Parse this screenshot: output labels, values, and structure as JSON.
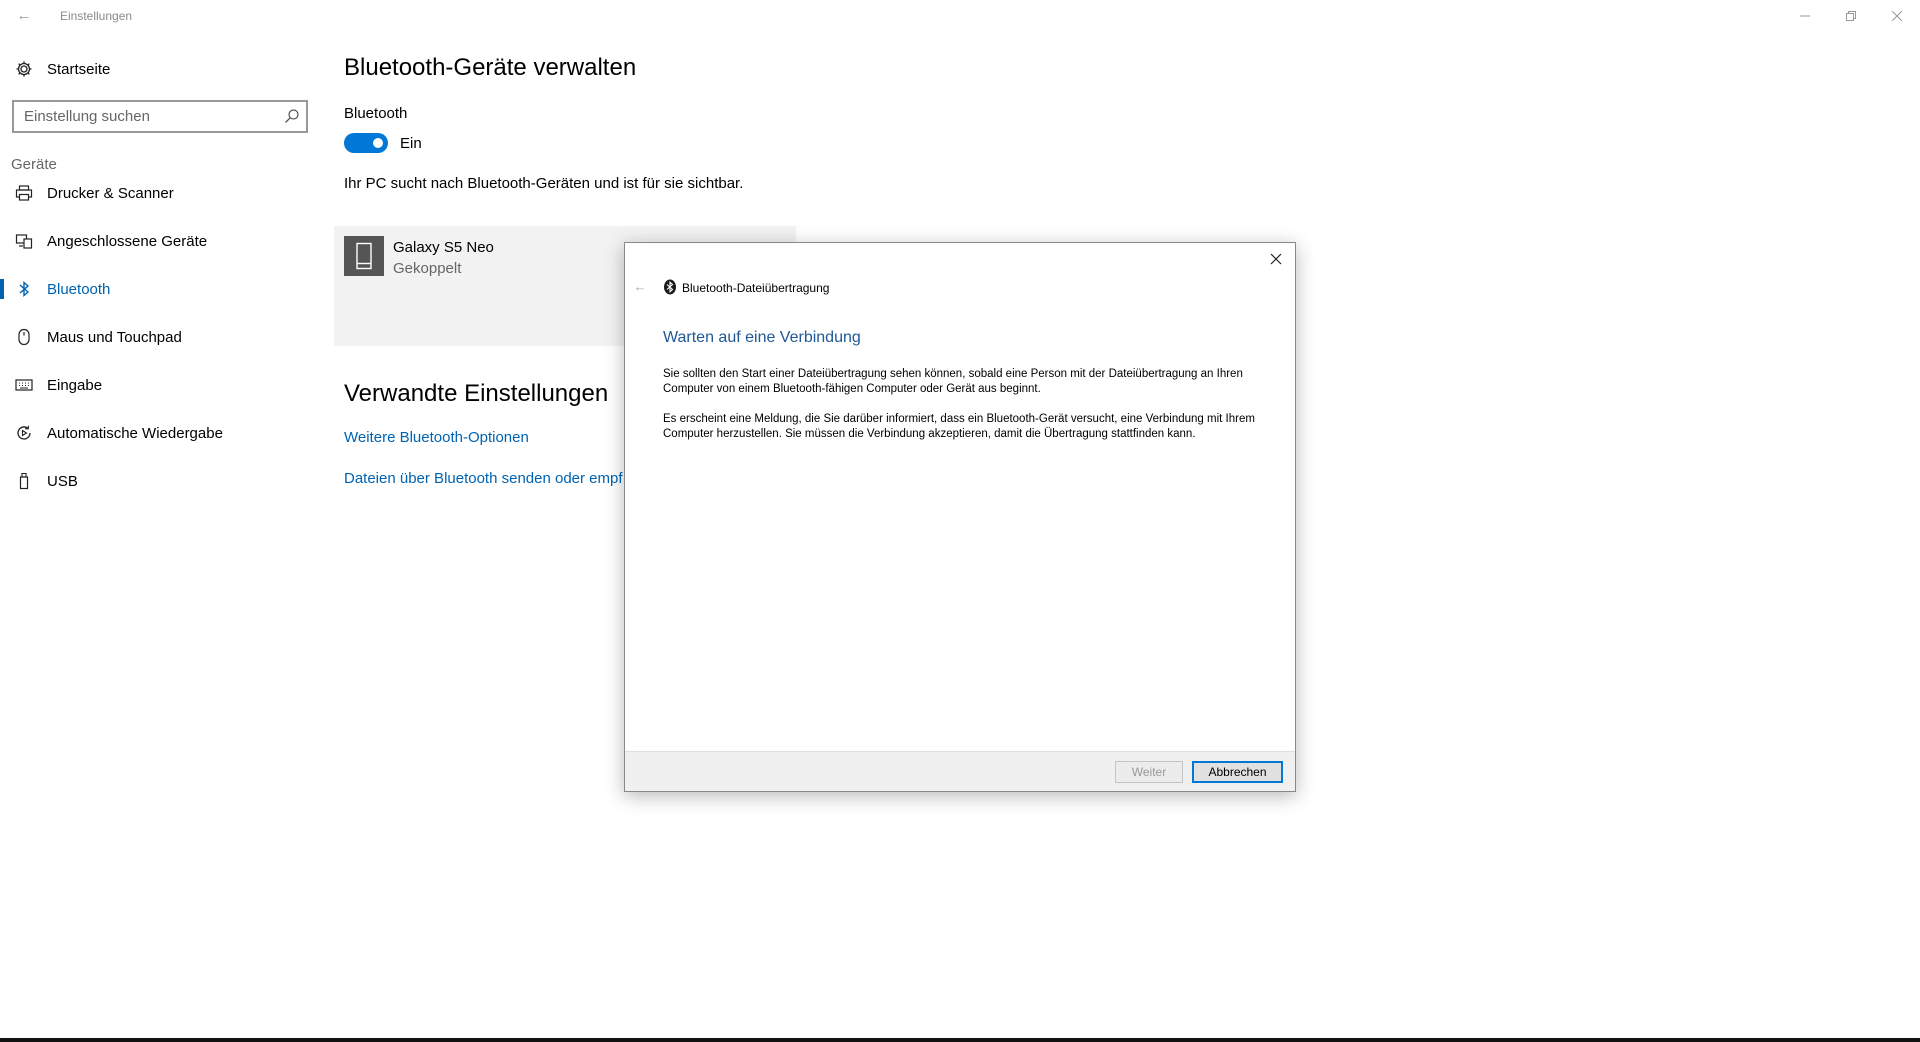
{
  "window": {
    "title": "Einstellungen",
    "back_icon": "back-arrow-icon"
  },
  "sidebar": {
    "home_label": "Startseite",
    "search_placeholder": "Einstellung suchen",
    "section_label": "Geräte",
    "items": [
      {
        "label": "Drucker & Scanner",
        "icon": "printer-icon",
        "active": false
      },
      {
        "label": "Angeschlossene Geräte",
        "icon": "connected-devices-icon",
        "active": false
      },
      {
        "label": "Bluetooth",
        "icon": "bluetooth-icon",
        "active": true
      },
      {
        "label": "Maus und Touchpad",
        "icon": "mouse-icon",
        "active": false
      },
      {
        "label": "Eingabe",
        "icon": "keyboard-icon",
        "active": false
      },
      {
        "label": "Automatische Wiedergabe",
        "icon": "autoplay-icon",
        "active": false
      },
      {
        "label": "USB",
        "icon": "usb-icon",
        "active": false
      }
    ]
  },
  "main": {
    "title": "Bluetooth-Geräte verwalten",
    "bluetooth_label": "Bluetooth",
    "toggle_state": "Ein",
    "status_text": "Ihr PC sucht nach Bluetooth-Geräten und ist für sie sichtbar.",
    "device": {
      "name": "Galaxy S5 Neo",
      "status": "Gekoppelt"
    },
    "related_title": "Verwandte Einstellungen",
    "links": [
      "Weitere Bluetooth-Optionen",
      "Dateien über Bluetooth senden oder empf"
    ]
  },
  "dialog": {
    "title": "Bluetooth-Dateiübertragung",
    "heading": "Warten auf eine Verbindung",
    "paragraph1": "Sie sollten den Start einer Dateiübertragung sehen können, sobald eine Person mit der Dateiübertragung an Ihren Computer von einem Bluetooth-fähigen Computer oder Gerät aus beginnt.",
    "paragraph2": "Es erscheint eine Meldung, die Sie darüber informiert, dass ein Bluetooth-Gerät versucht, eine Verbindung mit Ihrem Computer herzustellen. Sie müssen die Verbindung akzeptieren, damit die Übertragung stattfinden kann.",
    "next_label": "Weiter",
    "cancel_label": "Abbrechen"
  },
  "colors": {
    "accent": "#0078d7",
    "link": "#0063b1",
    "dialog_heading": "#1f5897"
  }
}
